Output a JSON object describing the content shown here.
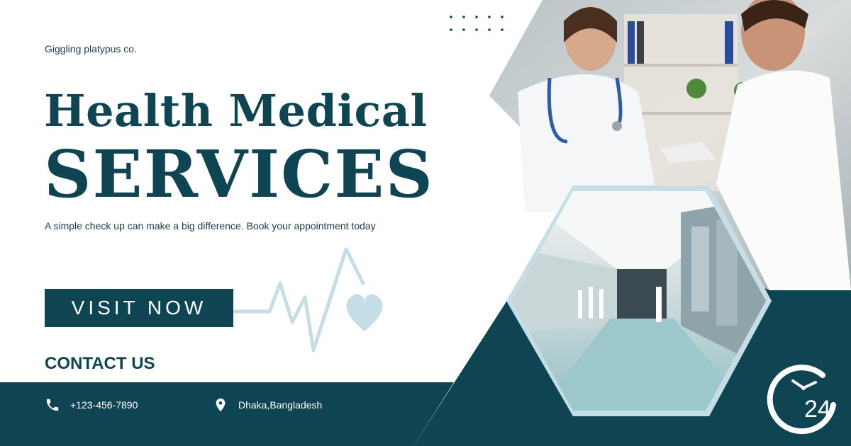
{
  "brand": "Giggling platypus co.",
  "title_line1": "Health Medical",
  "title_line2": "SERVICES",
  "tagline": "A simple check up can make a big difference. Book your appointment today",
  "cta_label": "VISIT NOW",
  "contact_heading": "CONTACT US",
  "phone": "+123-456-7890",
  "location": "Dhaka,Bangladesh",
  "clock_badge_number": "24",
  "colors": {
    "primary": "#0f4452",
    "light_accent": "#c5dde4",
    "background": "#ffffff"
  },
  "icons": [
    "phone-icon",
    "location-pin-icon",
    "clock-24-icon",
    "heartbeat-line-icon",
    "heart-icon"
  ]
}
